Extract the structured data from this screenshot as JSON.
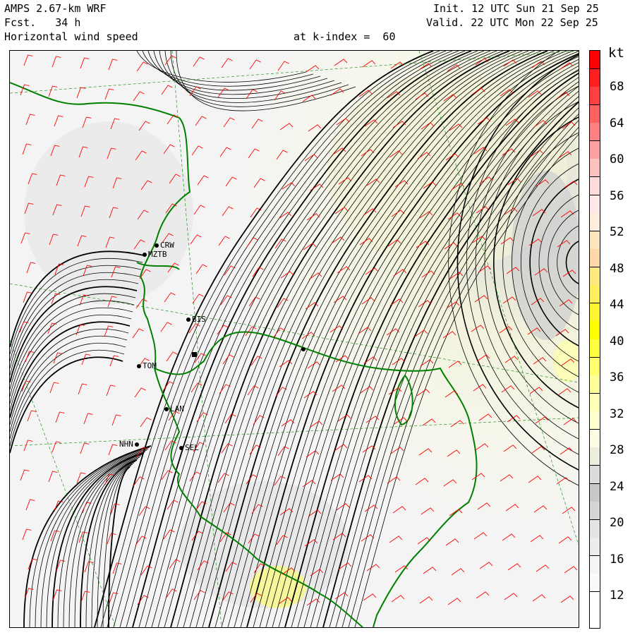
{
  "header": {
    "model": "AMPS 2.67-km WRF",
    "forecast": "Fcst.   34 h",
    "field": "Horizontal wind speed",
    "level": "at k-index =  60",
    "init": "Init. 12 UTC Sun 21 Sep 25",
    "valid": "Valid. 22 UTC Mon 22 Sep 25"
  },
  "colorbar": {
    "unit": "kt",
    "labels": [
      "68",
      "64",
      "60",
      "56",
      "52",
      "48",
      "44",
      "40",
      "36",
      "32",
      "28",
      "24",
      "20",
      "16",
      "12"
    ],
    "segments": [
      {
        "color": "#ff0000"
      },
      {
        "color": "#ff1f1f"
      },
      {
        "color": "#ff4040"
      },
      {
        "color": "#ff6060"
      },
      {
        "color": "#ff8080"
      },
      {
        "color": "#ff9f9f"
      },
      {
        "color": "#ffc0c0"
      },
      {
        "color": "#ffdada"
      },
      {
        "color": "#ffe8e8"
      },
      {
        "color": "#ffeedd"
      },
      {
        "color": "#ffe4c0"
      },
      {
        "color": "#ffd8a8"
      },
      {
        "color": "#ffe880"
      },
      {
        "color": "#ffee60"
      },
      {
        "color": "#fff530"
      },
      {
        "color": "#ffff00"
      },
      {
        "color": "#ffff40"
      },
      {
        "color": "#ffff70"
      },
      {
        "color": "#ffff99"
      },
      {
        "color": "#ffffb8"
      },
      {
        "color": "#ffffd0"
      },
      {
        "color": "#fffce6"
      },
      {
        "color": "#eeeede"
      },
      {
        "color": "#dcdcdc"
      },
      {
        "color": "#c8c8c8"
      },
      {
        "color": "#d6d6d6"
      },
      {
        "color": "#e4e4e4"
      },
      {
        "color": "#ececec"
      },
      {
        "color": "#f4f4f4"
      },
      {
        "color": "#fafafa"
      },
      {
        "color": "#ffffff"
      },
      {
        "color": "#ffffff"
      }
    ]
  },
  "stations": [
    "CRW",
    "MZTB",
    "BIS",
    "TOM",
    "LAN",
    "NHN",
    "SEL"
  ],
  "colors": {
    "coastline": "#008000",
    "graticule": "#008000",
    "streamline": "#000000",
    "barb": "#ff0000"
  }
}
